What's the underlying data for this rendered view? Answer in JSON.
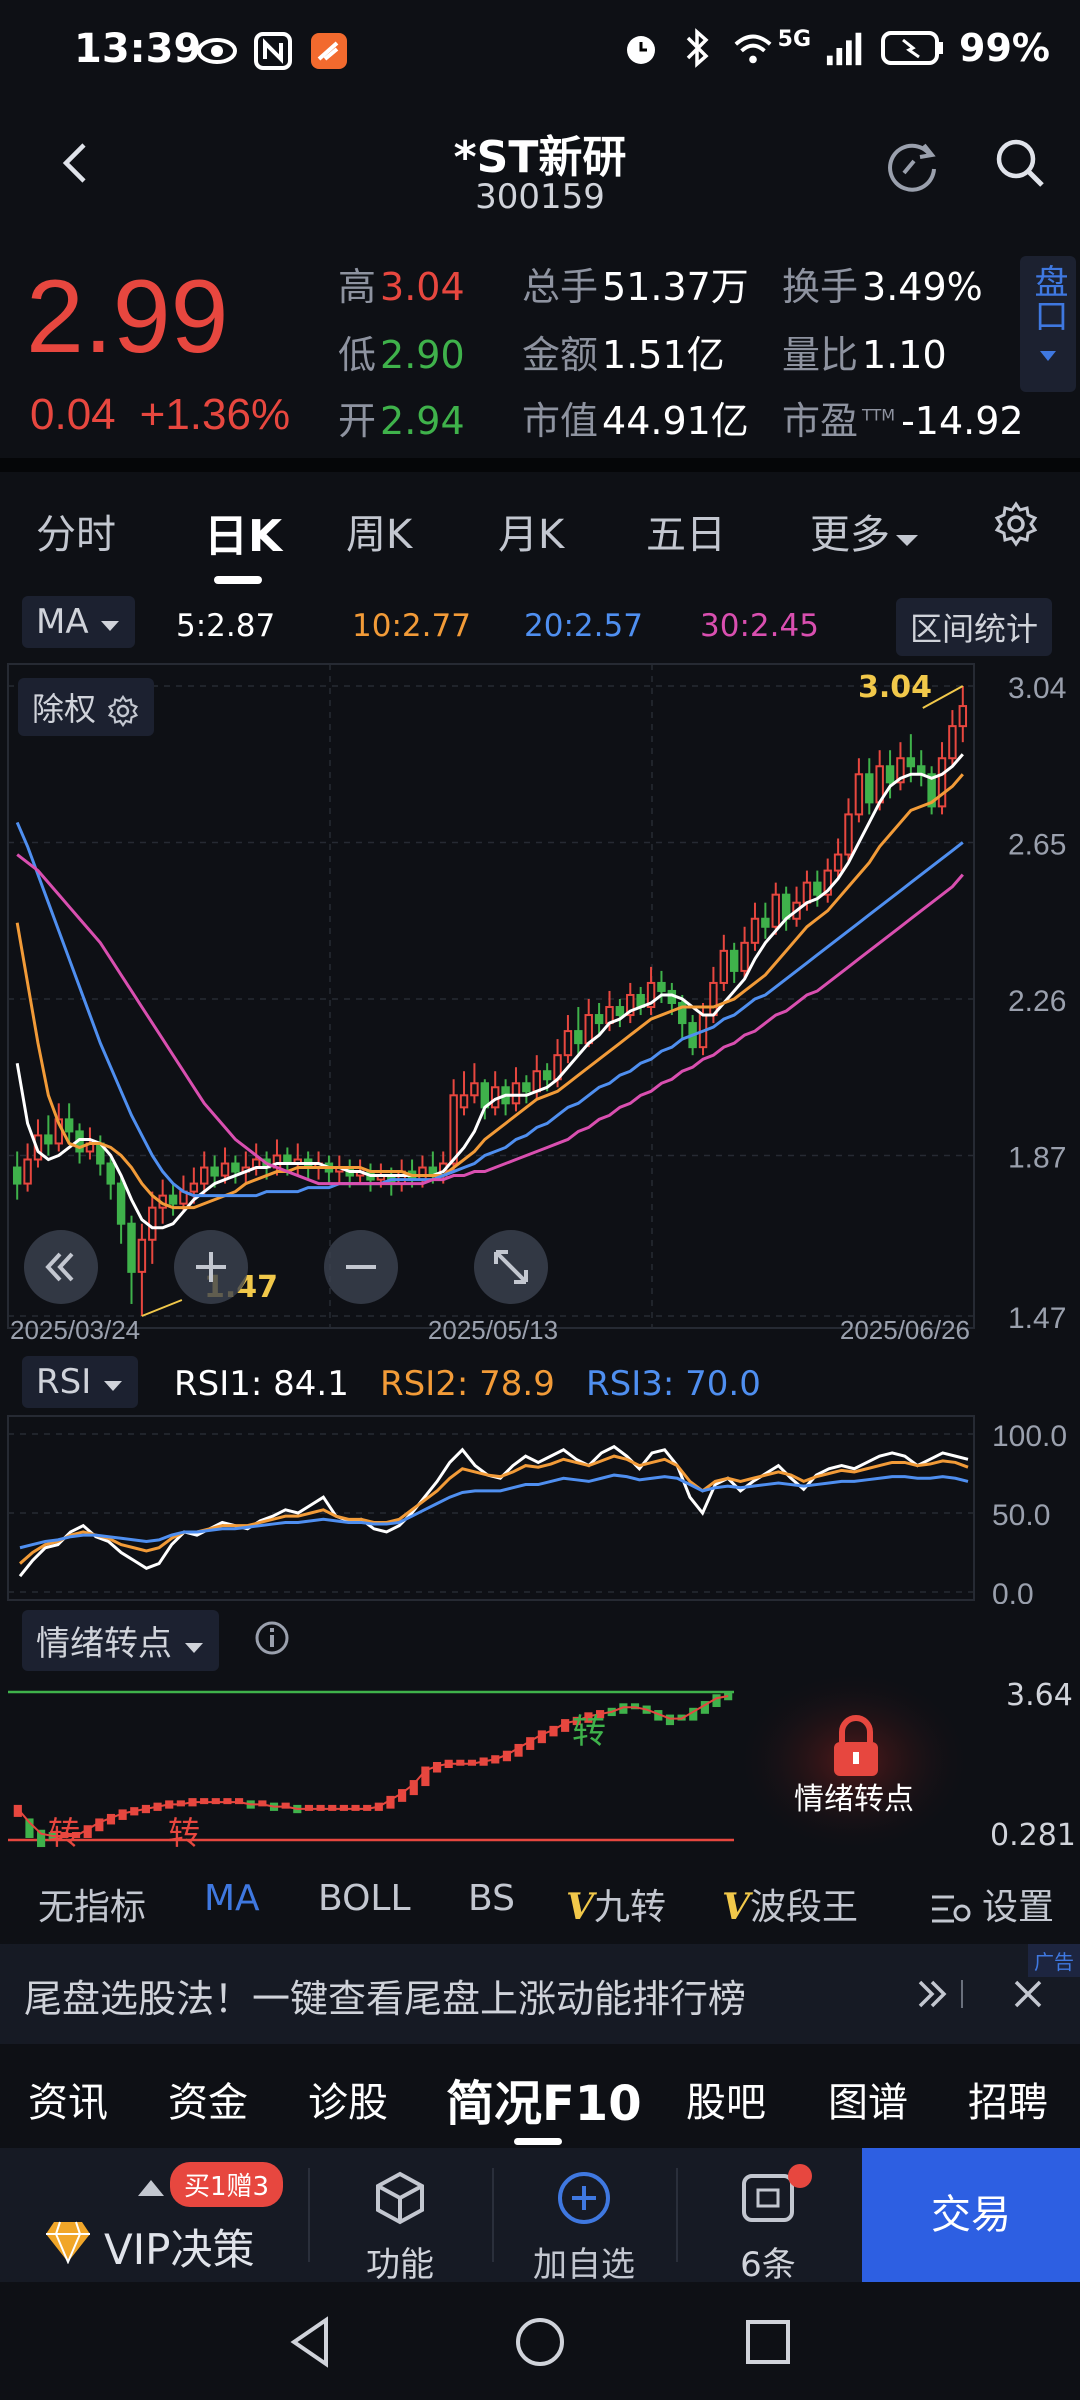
{
  "status": {
    "time": "13:39",
    "network": "5G",
    "battery": "99%",
    "icons": [
      "eye-icon",
      "nfc-icon",
      "app-notification-icon",
      "alarm-icon",
      "bluetooth-icon",
      "wifi-icon",
      "signal-icon",
      "battery-icon"
    ]
  },
  "header": {
    "title": "*ST新研",
    "code": "300159"
  },
  "quote": {
    "price": "2.99",
    "change": "0.04",
    "change_pct": "+1.36%",
    "high_label": "高",
    "high": "3.04",
    "low_label": "低",
    "low": "2.90",
    "open_label": "开",
    "open": "2.94",
    "volume_label": "总手",
    "volume": "51.37万",
    "amount_label": "金额",
    "amount": "1.51亿",
    "mcap_label": "市值",
    "mcap": "44.91亿",
    "turnover_label": "换手",
    "turnover": "3.49%",
    "vol_ratio_label": "量比",
    "vol_ratio": "1.10",
    "pe_label": "市盈",
    "pe_sup": "TTM",
    "pe": "-14.92",
    "pankou": "盘口"
  },
  "tabs": {
    "items": [
      "分时",
      "日K",
      "周K",
      "月K",
      "五日",
      "更多"
    ],
    "active": "日K"
  },
  "ma_legend": {
    "selector": "MA",
    "ma5": "5:2.87",
    "ma10": "10:2.77",
    "ma20": "20:2.57",
    "ma30": "30:2.45",
    "range_stat": "区间统计"
  },
  "kchart": {
    "exright_label": "除权",
    "y_ticks": [
      "3.04",
      "2.65",
      "2.26",
      "1.87",
      "1.47"
    ],
    "x_labels": [
      "2025/03/24",
      "2025/05/13",
      "2025/06/26"
    ],
    "high_mark": "3.04",
    "low_mark": "1.47"
  },
  "rsi": {
    "selector": "RSI",
    "rsi1": "RSI1: 84.1",
    "rsi2": "RSI2: 78.9",
    "rsi3": "RSI3: 70.0",
    "y_ticks": [
      "100.0",
      "50.0",
      "0.0"
    ]
  },
  "emotion": {
    "selector": "情绪转点",
    "top_value": "3.64",
    "bottom_value": "0.281",
    "mark": "转",
    "lock_label": "情绪转点"
  },
  "indicators": {
    "items": [
      "无指标",
      "MA",
      "BOLL",
      "BS",
      "九转",
      "波段王"
    ],
    "active": "MA",
    "settings": "设置"
  },
  "ad": {
    "text": "尾盘选股法！一键查看尾盘上涨动能排行榜",
    "tag": "广告"
  },
  "f10": {
    "items": [
      "资讯",
      "资金",
      "诊股",
      "简况F10",
      "股吧",
      "图谱",
      "招聘"
    ],
    "active": "简况F10"
  },
  "bottom": {
    "vip_badge": "买1赠3",
    "vip": "VIP决策",
    "func": "功能",
    "add": "加自选",
    "ask": "6条",
    "trade": "交易"
  },
  "chart_data": {
    "type": "candlestick",
    "x_labels": [
      "2025/03/24",
      "2025/05/13",
      "2025/06/26"
    ],
    "ylim": [
      1.47,
      3.04
    ],
    "y_ticks": [
      1.47,
      1.87,
      2.26,
      2.65,
      3.04
    ],
    "candles": [
      [
        1.84,
        1.8,
        1.88,
        1.76
      ],
      [
        1.8,
        1.86,
        1.9,
        1.78
      ],
      [
        1.86,
        1.92,
        1.96,
        1.84
      ],
      [
        1.92,
        1.9,
        1.97,
        1.87
      ],
      [
        1.9,
        1.96,
        2.0,
        1.88
      ],
      [
        1.96,
        1.93,
        2.0,
        1.9
      ],
      [
        1.93,
        1.88,
        1.95,
        1.85
      ],
      [
        1.88,
        1.9,
        1.94,
        1.86
      ],
      [
        1.9,
        1.85,
        1.92,
        1.82
      ],
      [
        1.85,
        1.8,
        1.87,
        1.76
      ],
      [
        1.8,
        1.7,
        1.82,
        1.65
      ],
      [
        1.7,
        1.58,
        1.72,
        1.5
      ],
      [
        1.58,
        1.66,
        1.7,
        1.47
      ],
      [
        1.66,
        1.74,
        1.78,
        1.6
      ],
      [
        1.74,
        1.77,
        1.81,
        1.7
      ],
      [
        1.77,
        1.75,
        1.8,
        1.72
      ],
      [
        1.75,
        1.78,
        1.82,
        1.73
      ],
      [
        1.78,
        1.8,
        1.84,
        1.75
      ],
      [
        1.8,
        1.84,
        1.88,
        1.77
      ],
      [
        1.84,
        1.82,
        1.87,
        1.79
      ],
      [
        1.82,
        1.85,
        1.89,
        1.8
      ],
      [
        1.85,
        1.83,
        1.87,
        1.8
      ],
      [
        1.83,
        1.84,
        1.88,
        1.8
      ],
      [
        1.84,
        1.86,
        1.9,
        1.82
      ],
      [
        1.86,
        1.84,
        1.88,
        1.81
      ],
      [
        1.84,
        1.87,
        1.91,
        1.82
      ],
      [
        1.87,
        1.85,
        1.89,
        1.82
      ],
      [
        1.85,
        1.86,
        1.9,
        1.82
      ],
      [
        1.86,
        1.84,
        1.88,
        1.81
      ],
      [
        1.84,
        1.85,
        1.88,
        1.81
      ],
      [
        1.85,
        1.83,
        1.87,
        1.8
      ],
      [
        1.83,
        1.84,
        1.87,
        1.8
      ],
      [
        1.84,
        1.82,
        1.86,
        1.79
      ],
      [
        1.82,
        1.83,
        1.86,
        1.8
      ],
      [
        1.83,
        1.81,
        1.85,
        1.78
      ],
      [
        1.81,
        1.82,
        1.85,
        1.79
      ],
      [
        1.82,
        1.8,
        1.84,
        1.77
      ],
      [
        1.8,
        1.83,
        1.86,
        1.78
      ],
      [
        1.83,
        1.81,
        1.86,
        1.79
      ],
      [
        1.81,
        1.84,
        1.87,
        1.79
      ],
      [
        1.84,
        1.82,
        1.88,
        1.8
      ],
      [
        1.82,
        1.85,
        1.88,
        1.8
      ],
      [
        1.85,
        2.02,
        2.06,
        1.83
      ],
      [
        1.99,
        2.02,
        2.08,
        1.97
      ],
      [
        2.02,
        2.05,
        2.1,
        2.0
      ],
      [
        2.05,
        1.99,
        2.06,
        1.96
      ],
      [
        1.99,
        2.04,
        2.08,
        1.97
      ],
      [
        2.04,
        2.0,
        2.06,
        1.97
      ],
      [
        2.0,
        2.05,
        2.09,
        1.98
      ],
      [
        2.05,
        2.03,
        2.07,
        2.0
      ],
      [
        2.03,
        2.08,
        2.12,
        2.01
      ],
      [
        2.08,
        2.06,
        2.1,
        2.03
      ],
      [
        2.06,
        2.12,
        2.16,
        2.04
      ],
      [
        2.12,
        2.18,
        2.22,
        2.1
      ],
      [
        2.18,
        2.15,
        2.24,
        2.12
      ],
      [
        2.15,
        2.22,
        2.26,
        2.14
      ],
      [
        2.22,
        2.2,
        2.25,
        2.17
      ],
      [
        2.2,
        2.24,
        2.28,
        2.18
      ],
      [
        2.24,
        2.22,
        2.26,
        2.19
      ],
      [
        2.22,
        2.27,
        2.3,
        2.2
      ],
      [
        2.27,
        2.24,
        2.29,
        2.22
      ],
      [
        2.24,
        2.3,
        2.34,
        2.22
      ],
      [
        2.3,
        2.28,
        2.33,
        2.25
      ],
      [
        2.28,
        2.25,
        2.3,
        2.22
      ],
      [
        2.25,
        2.2,
        2.27,
        2.16
      ],
      [
        2.2,
        2.14,
        2.22,
        2.12
      ],
      [
        2.14,
        2.22,
        2.25,
        2.12
      ],
      [
        2.22,
        2.3,
        2.34,
        2.2
      ],
      [
        2.3,
        2.38,
        2.42,
        2.28
      ],
      [
        2.38,
        2.33,
        2.4,
        2.3
      ],
      [
        2.33,
        2.4,
        2.44,
        2.31
      ],
      [
        2.4,
        2.46,
        2.5,
        2.38
      ],
      [
        2.46,
        2.44,
        2.5,
        2.41
      ],
      [
        2.44,
        2.52,
        2.55,
        2.42
      ],
      [
        2.52,
        2.46,
        2.54,
        2.43
      ],
      [
        2.46,
        2.5,
        2.54,
        2.44
      ],
      [
        2.5,
        2.55,
        2.58,
        2.48
      ],
      [
        2.55,
        2.52,
        2.58,
        2.49
      ],
      [
        2.52,
        2.58,
        2.61,
        2.5
      ],
      [
        2.58,
        2.62,
        2.66,
        2.56
      ],
      [
        2.62,
        2.72,
        2.76,
        2.6
      ],
      [
        2.72,
        2.82,
        2.86,
        2.7
      ],
      [
        2.82,
        2.75,
        2.86,
        2.72
      ],
      [
        2.75,
        2.84,
        2.88,
        2.73
      ],
      [
        2.84,
        2.8,
        2.88,
        2.76
      ],
      [
        2.8,
        2.86,
        2.9,
        2.78
      ],
      [
        2.86,
        2.84,
        2.92,
        2.8
      ],
      [
        2.84,
        2.82,
        2.88,
        2.79
      ],
      [
        2.82,
        2.74,
        2.84,
        2.72
      ],
      [
        2.74,
        2.86,
        2.9,
        2.72
      ],
      [
        2.86,
        2.94,
        2.98,
        2.84
      ],
      [
        2.94,
        2.99,
        3.04,
        2.9
      ]
    ],
    "ma": {
      "ma5": {
        "color": "#ffffff",
        "values": [
          2.1,
          1.95,
          1.88,
          1.86,
          1.87,
          1.89,
          1.91,
          1.91,
          1.9,
          1.87,
          1.82,
          1.76,
          1.71,
          1.69,
          1.69,
          1.7,
          1.73,
          1.76,
          1.78,
          1.8,
          1.81,
          1.82,
          1.83,
          1.84,
          1.84,
          1.85,
          1.85,
          1.85,
          1.85,
          1.85,
          1.84,
          1.84,
          1.83,
          1.83,
          1.82,
          1.82,
          1.82,
          1.82,
          1.82,
          1.82,
          1.82,
          1.83,
          1.86,
          1.89,
          1.93,
          1.99,
          2.01,
          2.02,
          2.02,
          2.02,
          2.03,
          2.04,
          2.06,
          2.09,
          2.12,
          2.15,
          2.17,
          2.2,
          2.21,
          2.23,
          2.24,
          2.25,
          2.27,
          2.27,
          2.26,
          2.24,
          2.22,
          2.22,
          2.25,
          2.28,
          2.31,
          2.36,
          2.4,
          2.43,
          2.46,
          2.48,
          2.5,
          2.51,
          2.53,
          2.56,
          2.6,
          2.65,
          2.7,
          2.75,
          2.79,
          2.81,
          2.82,
          2.82,
          2.81,
          2.82,
          2.84,
          2.87
        ]
      },
      "ma10": {
        "color": "#f29b38",
        "values": [
          2.45,
          2.3,
          2.15,
          2.02,
          1.95,
          1.9,
          1.89,
          1.9,
          1.9,
          1.89,
          1.87,
          1.84,
          1.8,
          1.77,
          1.75,
          1.74,
          1.74,
          1.74,
          1.75,
          1.76,
          1.77,
          1.78,
          1.8,
          1.81,
          1.82,
          1.83,
          1.83,
          1.84,
          1.84,
          1.84,
          1.84,
          1.84,
          1.84,
          1.84,
          1.83,
          1.83,
          1.83,
          1.83,
          1.82,
          1.82,
          1.82,
          1.82,
          1.84,
          1.86,
          1.88,
          1.91,
          1.93,
          1.95,
          1.97,
          1.99,
          2.01,
          2.02,
          2.03,
          2.05,
          2.07,
          2.09,
          2.11,
          2.13,
          2.15,
          2.17,
          2.19,
          2.21,
          2.22,
          2.23,
          2.24,
          2.24,
          2.24,
          2.24,
          2.25,
          2.26,
          2.28,
          2.3,
          2.32,
          2.35,
          2.38,
          2.41,
          2.44,
          2.46,
          2.48,
          2.51,
          2.54,
          2.57,
          2.6,
          2.64,
          2.67,
          2.7,
          2.73,
          2.74,
          2.75,
          2.77,
          2.79,
          2.82
        ]
      },
      "ma20": {
        "color": "#4f8ff0",
        "values": [
          2.7,
          2.64,
          2.57,
          2.5,
          2.43,
          2.36,
          2.29,
          2.22,
          2.15,
          2.09,
          2.03,
          1.97,
          1.92,
          1.87,
          1.83,
          1.8,
          1.78,
          1.77,
          1.77,
          1.77,
          1.77,
          1.77,
          1.77,
          1.77,
          1.78,
          1.78,
          1.78,
          1.78,
          1.79,
          1.79,
          1.79,
          1.8,
          1.8,
          1.8,
          1.8,
          1.8,
          1.81,
          1.81,
          1.81,
          1.81,
          1.81,
          1.82,
          1.83,
          1.84,
          1.85,
          1.87,
          1.88,
          1.89,
          1.91,
          1.92,
          1.94,
          1.95,
          1.97,
          1.99,
          2.0,
          2.02,
          2.04,
          2.05,
          2.07,
          2.08,
          2.1,
          2.11,
          2.13,
          2.14,
          2.16,
          2.17,
          2.18,
          2.19,
          2.21,
          2.22,
          2.24,
          2.26,
          2.27,
          2.29,
          2.31,
          2.33,
          2.35,
          2.37,
          2.39,
          2.41,
          2.43,
          2.45,
          2.47,
          2.49,
          2.51,
          2.53,
          2.55,
          2.57,
          2.59,
          2.61,
          2.63,
          2.65
        ]
      },
      "ma30": {
        "color": "#d94fb0",
        "values": [
          2.62,
          2.6,
          2.58,
          2.55,
          2.52,
          2.49,
          2.46,
          2.43,
          2.4,
          2.36,
          2.32,
          2.28,
          2.24,
          2.2,
          2.16,
          2.12,
          2.08,
          2.04,
          2.0,
          1.97,
          1.94,
          1.91,
          1.89,
          1.87,
          1.85,
          1.84,
          1.83,
          1.82,
          1.81,
          1.8,
          1.8,
          1.8,
          1.8,
          1.8,
          1.8,
          1.8,
          1.8,
          1.8,
          1.8,
          1.8,
          1.81,
          1.81,
          1.82,
          1.82,
          1.83,
          1.83,
          1.84,
          1.85,
          1.86,
          1.87,
          1.88,
          1.89,
          1.9,
          1.91,
          1.93,
          1.94,
          1.96,
          1.97,
          1.99,
          2.0,
          2.02,
          2.03,
          2.05,
          2.06,
          2.08,
          2.09,
          2.11,
          2.12,
          2.14,
          2.15,
          2.17,
          2.18,
          2.2,
          2.22,
          2.23,
          2.25,
          2.27,
          2.28,
          2.3,
          2.32,
          2.34,
          2.36,
          2.38,
          2.4,
          2.42,
          2.44,
          2.46,
          2.48,
          2.5,
          2.52,
          2.54,
          2.57
        ]
      }
    },
    "rsi_series": {
      "rsi1": {
        "color": "#ffffff",
        "values": [
          10,
          20,
          28,
          30,
          38,
          42,
          35,
          32,
          25,
          20,
          15,
          18,
          30,
          38,
          36,
          40,
          44,
          42,
          40,
          45,
          48,
          52,
          50,
          55,
          60,
          48,
          45,
          46,
          40,
          38,
          42,
          50,
          60,
          70,
          82,
          90,
          80,
          74,
          72,
          80,
          86,
          82,
          86,
          90,
          84,
          80,
          88,
          92,
          86,
          78,
          88,
          90,
          80,
          60,
          50,
          68,
          72,
          64,
          70,
          75,
          80,
          72,
          65,
          74,
          78,
          80,
          78,
          82,
          86,
          88,
          86,
          80,
          84,
          88,
          86,
          84
        ]
      },
      "rsi2": {
        "color": "#f29b38",
        "values": [
          18,
          25,
          30,
          32,
          36,
          38,
          36,
          34,
          30,
          28,
          26,
          28,
          34,
          38,
          38,
          40,
          42,
          42,
          42,
          44,
          46,
          48,
          48,
          50,
          52,
          48,
          46,
          46,
          44,
          44,
          46,
          52,
          58,
          64,
          72,
          78,
          76,
          74,
          73,
          76,
          80,
          79,
          81,
          84,
          82,
          80,
          83,
          86,
          84,
          80,
          82,
          84,
          80,
          70,
          64,
          70,
          72,
          70,
          72,
          74,
          76,
          74,
          70,
          73,
          75,
          77,
          76,
          78,
          80,
          82,
          82,
          80,
          81,
          83,
          82,
          79
        ]
      },
      "rsi3": {
        "color": "#4f8ff0",
        "values": [
          28,
          30,
          32,
          33,
          35,
          36,
          36,
          35,
          34,
          33,
          32,
          33,
          36,
          38,
          38,
          39,
          40,
          40,
          41,
          42,
          43,
          44,
          44,
          45,
          46,
          45,
          44,
          44,
          43,
          43,
          44,
          48,
          52,
          56,
          60,
          63,
          64,
          64,
          64,
          66,
          68,
          68,
          70,
          72,
          71,
          70,
          72,
          74,
          73,
          71,
          72,
          73,
          72,
          68,
          64,
          66,
          67,
          66,
          67,
          68,
          69,
          68,
          67,
          68,
          69,
          70,
          70,
          71,
          72,
          73,
          73,
          72,
          72,
          73,
          72,
          70
        ]
      }
    }
  }
}
